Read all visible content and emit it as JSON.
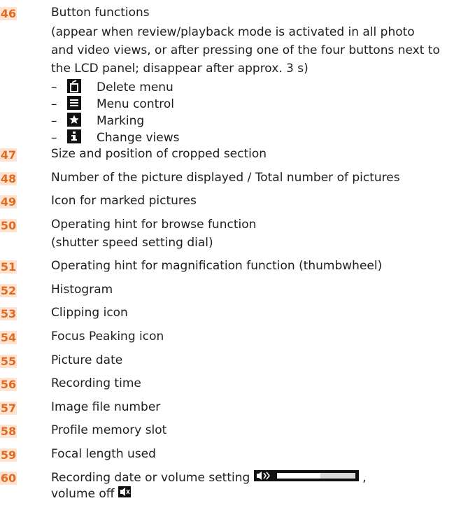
{
  "items": [
    {
      "num": "46",
      "lines": [
        "Button functions",
        "(appear when review/playback mode is activated in all photo",
        "and video views, or after pressing one of the four buttons next to",
        "the LCD panel; disappear after approx. 3 s)"
      ]
    },
    {
      "num": "47",
      "text": "Size and position of cropped section"
    },
    {
      "num": "48",
      "text": "Number of the picture displayed / Total number of pictures"
    },
    {
      "num": "49",
      "text": "Icon for marked pictures"
    },
    {
      "num": "50",
      "lines": [
        "Operating hint for browse function",
        "(shutter speed setting dial)"
      ]
    },
    {
      "num": "51",
      "text": "Operating hint for magnification function (thumbwheel)"
    },
    {
      "num": "52",
      "text": "Histogram"
    },
    {
      "num": "53",
      "text": "Clipping icon"
    },
    {
      "num": "54",
      "text": "Focus Peaking icon"
    },
    {
      "num": "55",
      "text": "Picture date"
    },
    {
      "num": "56",
      "text": "Recording time"
    },
    {
      "num": "57",
      "text": "Image file number"
    },
    {
      "num": "58",
      "text": "Profile memory slot"
    },
    {
      "num": "59",
      "text": "Focal length used"
    },
    {
      "num": "60",
      "lines": [
        "Recording date or volume setting",
        ", ",
        "volume off"
      ]
    }
  ],
  "button_functions": [
    {
      "dash": "–",
      "icon": "delete-icon",
      "label": "Delete menu"
    },
    {
      "dash": "–",
      "icon": "menu-icon",
      "label": "Menu control"
    },
    {
      "dash": "–",
      "icon": "star-icon",
      "label": "Marking"
    },
    {
      "dash": "–",
      "icon": "info-icon",
      "label": "Change views"
    }
  ],
  "volume_level": 0.55
}
